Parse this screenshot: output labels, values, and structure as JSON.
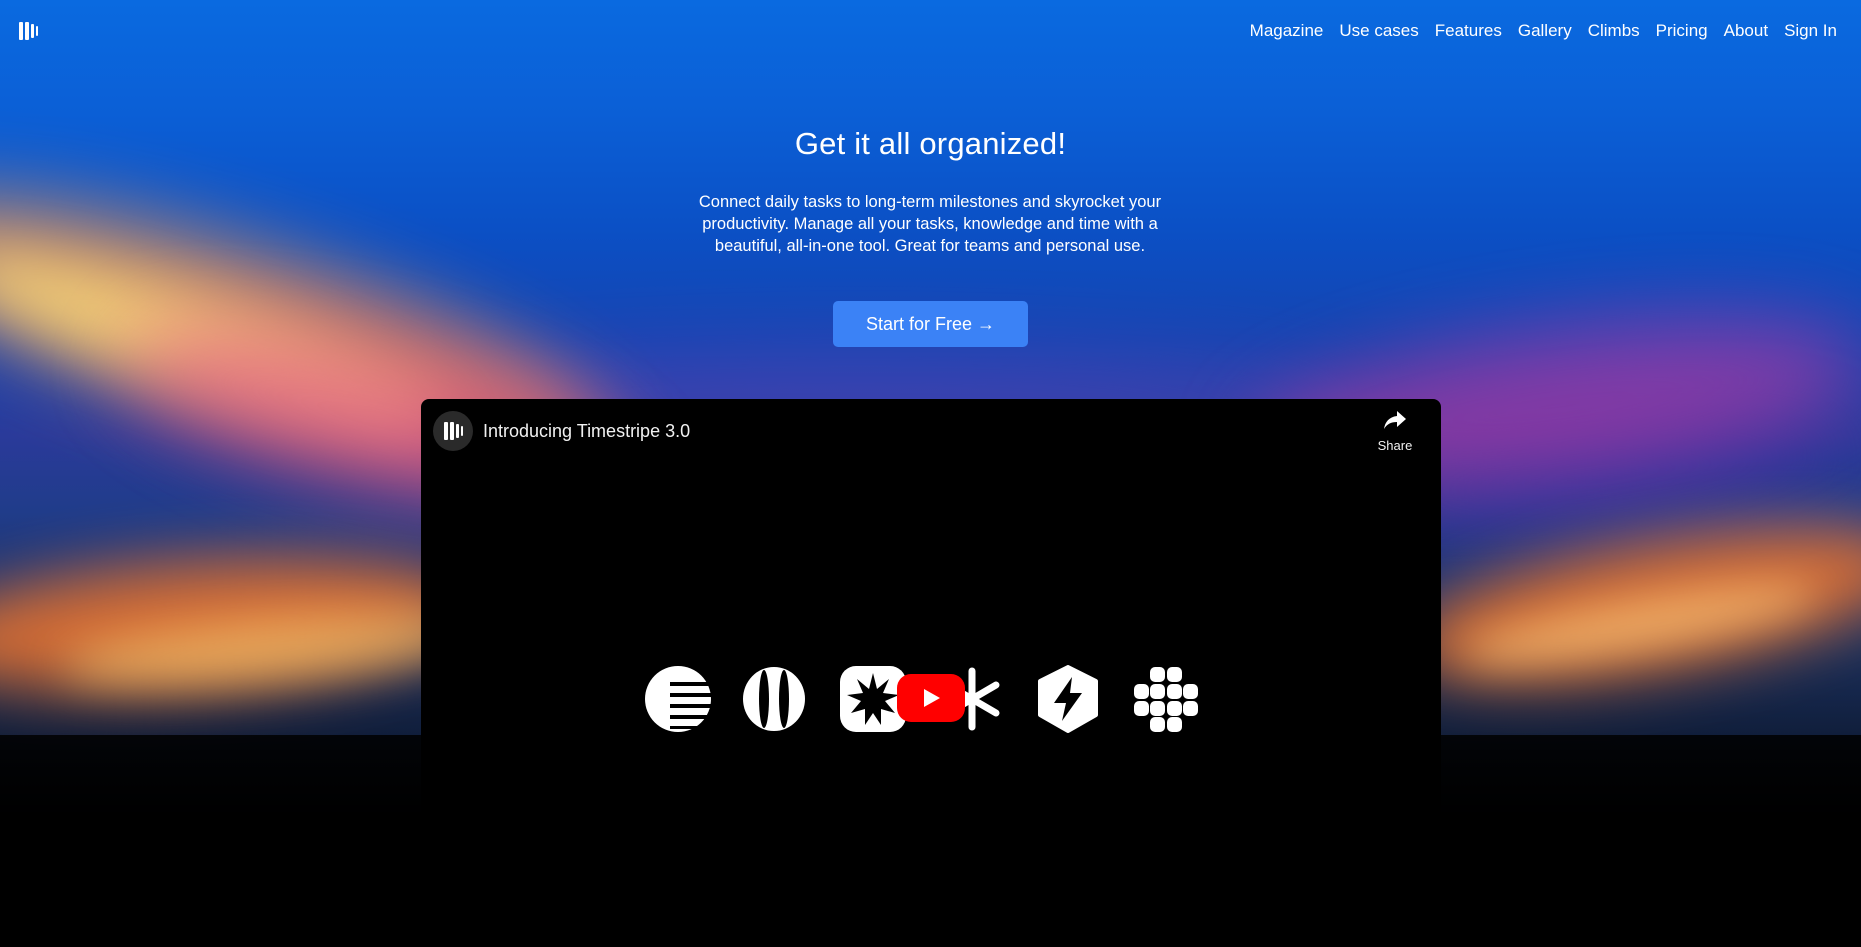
{
  "brand": {
    "logo_icon": "timestripe-logo-icon"
  },
  "nav": {
    "items": [
      {
        "label": "Magazine"
      },
      {
        "label": "Use cases"
      },
      {
        "label": "Features"
      },
      {
        "label": "Gallery"
      },
      {
        "label": "Climbs"
      },
      {
        "label": "Pricing"
      },
      {
        "label": "About"
      },
      {
        "label": "Sign In"
      }
    ]
  },
  "hero": {
    "title": "Get it all organized!",
    "subtitle": "Connect daily tasks to long-term milestones and skyrocket your productivity. Manage all your tasks, knowledge and time with a beautiful, all-in-one tool. Great for teams and personal use.",
    "cta_label": "Start for Free →",
    "cta_color": "#3b82f6"
  },
  "video": {
    "title": "Introducing Timestripe 3.0",
    "share_label": "Share",
    "play_button_color": "#ff0000",
    "icons": [
      "horizon-lines-icon",
      "globe-meridians-icon",
      "starburst-icon",
      "snowflake-icon",
      "lightning-hexagon-icon",
      "grid-blocks-icon"
    ]
  }
}
